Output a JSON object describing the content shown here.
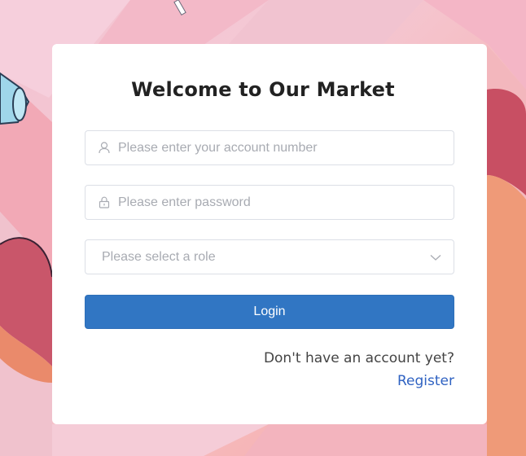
{
  "login_form": {
    "title": "Welcome to Our Market",
    "account_placeholder": "Please enter your account number",
    "password_placeholder": "Please enter password",
    "role_placeholder": "Please select a role",
    "login_label": "Login",
    "no_account_text": "Don't have an account yet?",
    "register_label": "Register"
  },
  "icons": {
    "account": "user-icon",
    "password": "lock-icon",
    "role": "chevron-down-icon"
  },
  "colors": {
    "primary": "#3176c3",
    "link": "#2f62c2",
    "placeholder": "#a8abb2",
    "border": "#dcdfe6"
  }
}
